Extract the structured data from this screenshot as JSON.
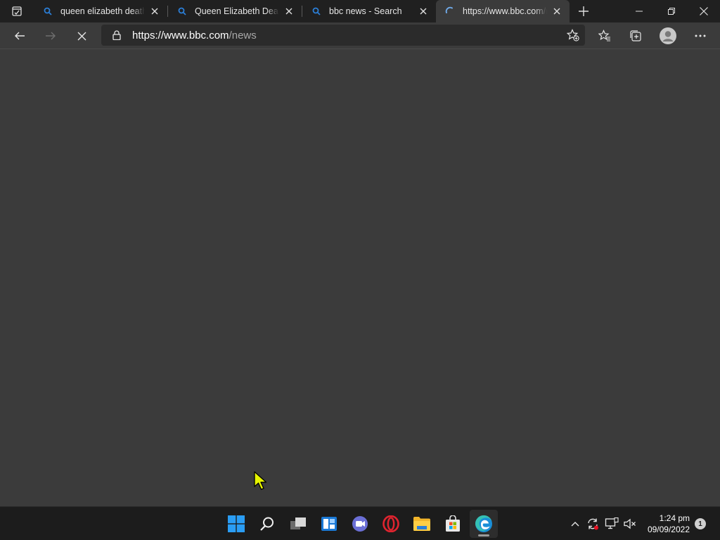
{
  "browser": {
    "tabs": [
      {
        "title": "queen elizabeth death - Search",
        "favicon": "search-icon",
        "active": false
      },
      {
        "title": "Queen Elizabeth Death - Search",
        "favicon": "search-icon",
        "active": false
      },
      {
        "title": "bbc news - Search",
        "favicon": "search-icon",
        "active": false
      },
      {
        "title": "https://www.bbc.com/news",
        "favicon": "loading-spinner-icon",
        "active": true
      }
    ],
    "address_bar": {
      "url_host": "https://www.bbc.com",
      "url_path": "/news"
    },
    "colors": {
      "accent": "#2b7fd8",
      "tabstrip_bg": "#202020",
      "toolbar_bg": "#3b3b3b",
      "page_bg": "#3b3b3b"
    }
  },
  "taskbar": {
    "apps": [
      {
        "name": "Start",
        "icon": "windows-start-icon"
      },
      {
        "name": "Search",
        "icon": "search-icon"
      },
      {
        "name": "Task View",
        "icon": "task-view-icon"
      },
      {
        "name": "Widgets",
        "icon": "widgets-icon"
      },
      {
        "name": "Chat",
        "icon": "teams-chat-icon"
      },
      {
        "name": "Opera",
        "icon": "opera-icon"
      },
      {
        "name": "File Explorer",
        "icon": "folder-icon"
      },
      {
        "name": "Microsoft Store",
        "icon": "store-icon"
      },
      {
        "name": "Microsoft Edge",
        "icon": "edge-icon",
        "running": true
      }
    ],
    "clock": {
      "time": "1:24 pm",
      "date": "09/09/2022"
    },
    "notification_count": "1"
  }
}
